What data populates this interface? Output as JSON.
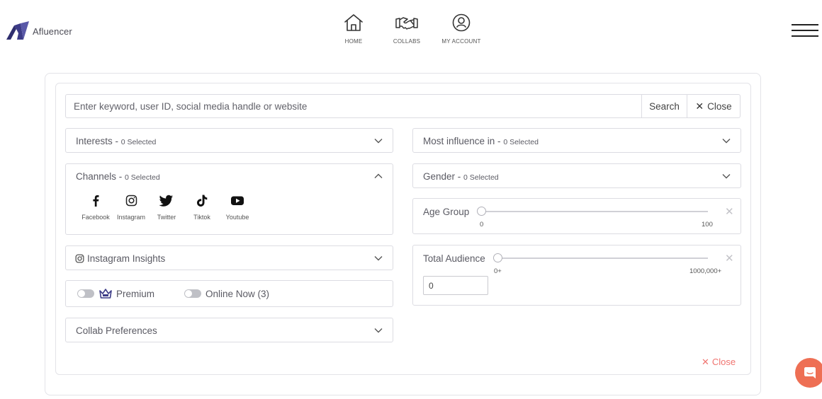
{
  "brand": {
    "name": "Afluencer",
    "color": "#3c3b87"
  },
  "nav": [
    {
      "label": "HOME",
      "icon": "home-icon"
    },
    {
      "label": "COLLABS",
      "icon": "handshake-icon"
    },
    {
      "label": "MY ACCOUNT",
      "icon": "user-circle-icon"
    }
  ],
  "search": {
    "placeholder": "Enter keyword, user ID, social media handle or website",
    "value": "",
    "search_label": "Search",
    "close_label": "Close"
  },
  "filters": {
    "interests": {
      "label": "Interests - ",
      "count": "0 Selected"
    },
    "channels": {
      "label": "Channels - ",
      "count": "0 Selected",
      "items": [
        {
          "label": "Facebook",
          "icon": "facebook-icon"
        },
        {
          "label": "Instagram",
          "icon": "instagram-icon"
        },
        {
          "label": "Twitter",
          "icon": "twitter-icon"
        },
        {
          "label": "Tiktok",
          "icon": "tiktok-icon"
        },
        {
          "label": "Youtube",
          "icon": "youtube-icon"
        }
      ]
    },
    "instagram_insights": {
      "label": "Instagram Insights"
    },
    "premium": {
      "label": "Premium",
      "enabled": false
    },
    "online_now": {
      "label": "Online Now (3)",
      "enabled": false
    },
    "collab_preferences": {
      "label": "Collab Preferences"
    },
    "most_influence": {
      "label": "Most influence in - ",
      "count": "0 Selected"
    },
    "gender": {
      "label": "Gender - ",
      "count": "0 Selected"
    },
    "age_group": {
      "label": "Age Group",
      "min_label": "0",
      "max_label": "100",
      "value": 0
    },
    "total_audience": {
      "label": "Total Audience",
      "min_label": "0+",
      "max_label": "1000,000+",
      "input_value": "0",
      "value": 0
    }
  },
  "footer": {
    "close_label": "Close",
    "close_color": "#f07470"
  },
  "chat": {
    "icon": "chat-icon",
    "color": "#ee6f54"
  }
}
